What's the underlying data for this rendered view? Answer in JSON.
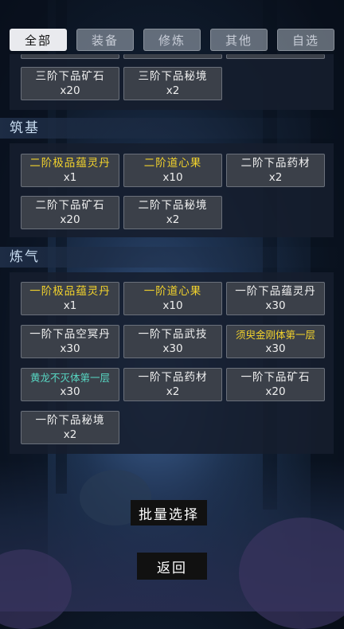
{
  "tabs": [
    {
      "label": "全部",
      "active": true
    },
    {
      "label": "装备",
      "active": false
    },
    {
      "label": "修炼",
      "active": false
    },
    {
      "label": "其他",
      "active": false
    },
    {
      "label": "自选",
      "active": false
    }
  ],
  "sections": {
    "top": {
      "items": [
        {
          "name": "三阶下品矿石",
          "count": "x20",
          "color": "white"
        },
        {
          "name": "三阶下品秘境",
          "count": "x2",
          "color": "white"
        }
      ]
    },
    "zhuji": {
      "title": "筑基",
      "items": [
        {
          "name": "二阶极品蕴灵丹",
          "count": "x1",
          "color": "gold"
        },
        {
          "name": "二阶道心果",
          "count": "x10",
          "color": "gold"
        },
        {
          "name": "二阶下品药材",
          "count": "x2",
          "color": "white"
        },
        {
          "name": "二阶下品矿石",
          "count": "x20",
          "color": "white"
        },
        {
          "name": "二阶下品秘境",
          "count": "x2",
          "color": "white"
        }
      ]
    },
    "lianqi": {
      "title": "炼气",
      "items": [
        {
          "name": "一阶极品蕴灵丹",
          "count": "x1",
          "color": "gold"
        },
        {
          "name": "一阶道心果",
          "count": "x10",
          "color": "gold"
        },
        {
          "name": "一阶下品蕴灵丹",
          "count": "x30",
          "color": "white"
        },
        {
          "name": "一阶下品空冥丹",
          "count": "x30",
          "color": "white"
        },
        {
          "name": "一阶下品武技",
          "count": "x30",
          "color": "white"
        },
        {
          "name": "须臾金刚体第一层",
          "count": "x30",
          "color": "gold"
        },
        {
          "name": "黄龙不灭体第一层",
          "count": "x30",
          "color": "teal"
        },
        {
          "name": "一阶下品药材",
          "count": "x2",
          "color": "white"
        },
        {
          "name": "一阶下品矿石",
          "count": "x20",
          "color": "white"
        },
        {
          "name": "一阶下品秘境",
          "count": "x2",
          "color": "white"
        }
      ]
    }
  },
  "buttons": {
    "batch_select": "批量选择",
    "back": "返回"
  }
}
